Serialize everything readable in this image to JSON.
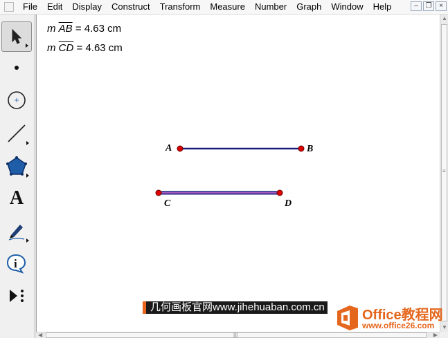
{
  "menu": [
    "File",
    "Edit",
    "Display",
    "Construct",
    "Transform",
    "Measure",
    "Number",
    "Graph",
    "Window",
    "Help"
  ],
  "window_controls": [
    "–",
    "Ὕ7",
    "×"
  ],
  "tools": [
    {
      "name": "arrow-tool",
      "icon": "arrow-icon"
    },
    {
      "name": "point-tool",
      "icon": "point-icon"
    },
    {
      "name": "compass-tool",
      "icon": "circle-icon"
    },
    {
      "name": "straightedge-tool",
      "icon": "line-icon"
    },
    {
      "name": "polygon-tool",
      "icon": "pentagon-icon"
    },
    {
      "name": "text-tool",
      "icon": "text-icon",
      "glyph": "A"
    },
    {
      "name": "marker-tool",
      "icon": "marker-icon"
    },
    {
      "name": "information-tool",
      "icon": "info-icon",
      "glyph": "i"
    },
    {
      "name": "custom-tool",
      "icon": "play-more-icon"
    }
  ],
  "measurements": [
    {
      "prefix": "m",
      "segment": "AB",
      "value": "= 4.63 cm"
    },
    {
      "prefix": "m",
      "segment": "CD",
      "value": "= 4.63 cm"
    }
  ],
  "points": {
    "A": "A",
    "B": "B",
    "C": "C",
    "D": "D"
  },
  "colors": {
    "segment_ab": "#1a1a80",
    "segment_cd_outer": "#1a1a80",
    "segment_cd_inner": "#c060c0",
    "point_fill": "#dd0000"
  },
  "watermarks": {
    "left": "几何画板官网www.jihehuaban.com.cn",
    "brand": "Office教程网",
    "brand_url": "www.office26.com"
  }
}
